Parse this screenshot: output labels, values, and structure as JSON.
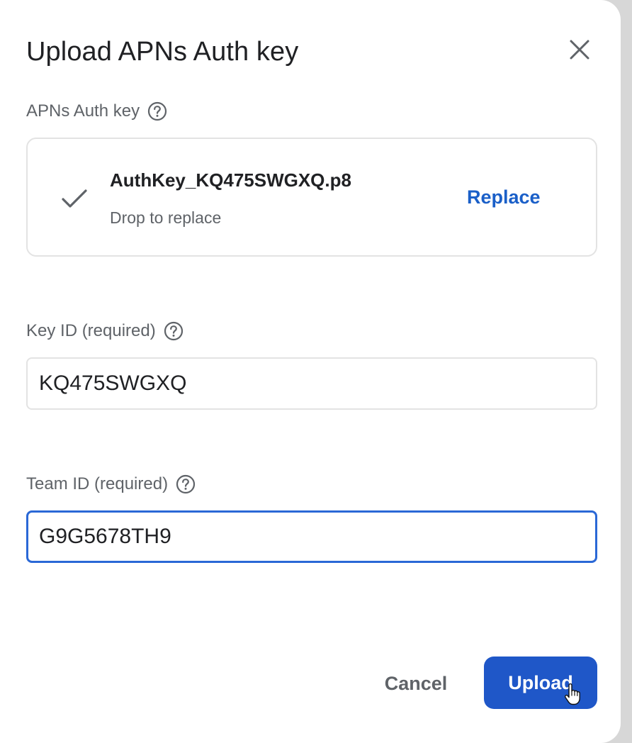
{
  "dialog": {
    "title": "Upload APNs Auth key",
    "close_icon": "close-icon"
  },
  "auth_key": {
    "label": "APNs Auth key",
    "help_icon": "help-circle-icon",
    "file_name": "AuthKey_KQ475SWGXQ.p8",
    "hint": "Drop to replace",
    "replace_label": "Replace",
    "status_icon": "checkmark-icon"
  },
  "key_id": {
    "label": "Key ID (required)",
    "help_icon": "help-circle-icon",
    "value": "KQ475SWGXQ"
  },
  "team_id": {
    "label": "Team ID (required)",
    "help_icon": "help-circle-icon",
    "value": "G9G5678TH9"
  },
  "actions": {
    "cancel_label": "Cancel",
    "upload_label": "Upload"
  },
  "colors": {
    "accent": "#1f57c8",
    "link": "#1a5fc8",
    "focus_border": "#2a68d6",
    "muted_text": "#5f6368"
  }
}
